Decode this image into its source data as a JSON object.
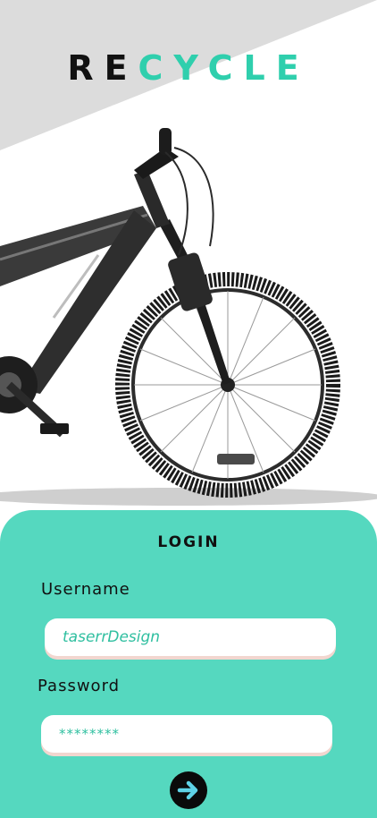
{
  "brand": {
    "part1": "RE",
    "part2": "CYCLE"
  },
  "login": {
    "title": "LOGIN",
    "username_label": "Username",
    "username_value": "taserrDesign",
    "password_label": "Password",
    "password_value": "********",
    "submit_icon": "arrow-right-icon"
  },
  "colors": {
    "accent": "#2fcfad",
    "card": "#55d8bf",
    "dark": "#111111",
    "diagonal": "#dcdcdc"
  }
}
